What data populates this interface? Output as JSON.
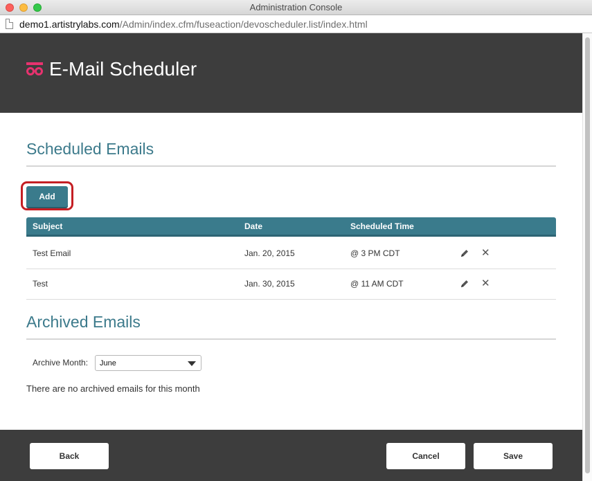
{
  "window": {
    "title": "Administration Console"
  },
  "address": {
    "host": "demo1.artistrylabs.com",
    "path": "/Admin/index.cfm/fuseaction/devoscheduler.list/index.html"
  },
  "header": {
    "title": "E-Mail Scheduler",
    "logo_icon": "infinity-loop-icon",
    "accent_color": "#e8326f"
  },
  "scheduled": {
    "title": "Scheduled Emails",
    "add_label": "Add",
    "columns": [
      "Subject",
      "Date",
      "Scheduled Time"
    ],
    "rows": [
      {
        "subject": "Test Email",
        "date": "Jan. 20, 2015",
        "time": "@ 3 PM CDT"
      },
      {
        "subject": "Test",
        "date": "Jan. 30, 2015",
        "time": "@ 11 AM CDT"
      }
    ],
    "row_actions": [
      "pencil-icon",
      "close-icon"
    ]
  },
  "archived": {
    "title": "Archived Emails",
    "month_label": "Archive Month:",
    "selected_month": "June",
    "empty_message": "There are no archived emails for this month"
  },
  "footer": {
    "back_label": "Back",
    "cancel_label": "Cancel",
    "save_label": "Save"
  },
  "colors": {
    "primary": "#3a7b8c",
    "header_bg": "#3d3d3d",
    "highlight": "#c41e23"
  }
}
